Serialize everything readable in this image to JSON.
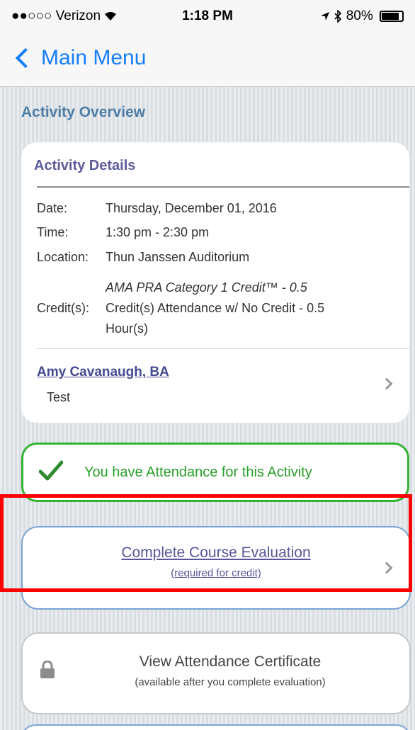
{
  "status_bar": {
    "signal": "●●○○○",
    "carrier": "Verizon",
    "time": "1:18 PM",
    "battery": "80%",
    "battery_level": 0.8
  },
  "nav": {
    "back_label": "Main Menu"
  },
  "page": {
    "section_title": "Activity Overview"
  },
  "details": {
    "title": "Activity Details",
    "date_label": "Date:",
    "date_value": "Thursday, December 01, 2016",
    "time_label": "Time:",
    "time_value": "1:30 pm - 2:30 pm",
    "location_label": "Location:",
    "location_value": "Thun Janssen Auditorium",
    "credits_label": "Credit(s):",
    "credit_line1": "AMA PRA Category 1 Credit™ - 0.5",
    "credit_line2": "Credit(s) Attendance w/ No Credit - 0.5",
    "credit_line3": "Hour(s)",
    "presenter_name": "Amy Cavanaugh, BA",
    "presenter_role": "Test"
  },
  "attendance": {
    "text": "You have Attendance for this Activity"
  },
  "evaluation": {
    "title": "Complete Course Evaluation",
    "subtitle": "(required for credit)"
  },
  "certificate": {
    "title": "View Attendance Certificate",
    "subtitle": "(available after you complete evaluation)"
  },
  "colors": {
    "ios_blue": "#157efb",
    "success_green": "#34b234",
    "highlight_red": "#ff0000",
    "eval_border": "#7aa6d4"
  }
}
